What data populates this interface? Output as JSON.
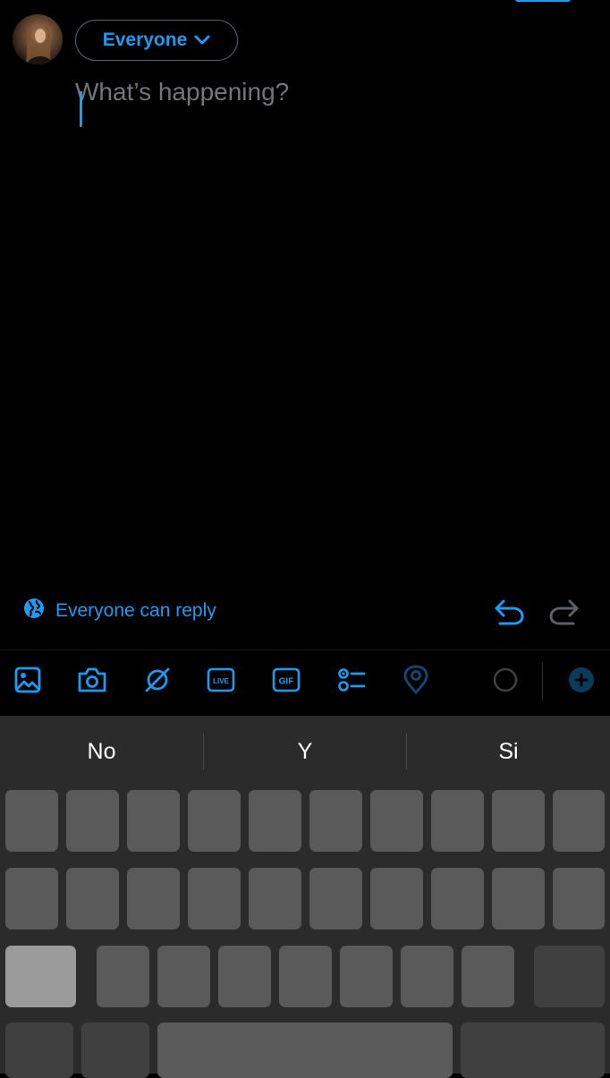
{
  "header": {
    "audience_label": "Everyone"
  },
  "composer": {
    "placeholder": "What’s happening?"
  },
  "reply_setting": {
    "label": "Everyone can reply"
  },
  "toolbar": {
    "icons": [
      "image-icon",
      "camera-icon",
      "grok-icon",
      "live-icon",
      "gif-icon",
      "poll-icon",
      "location-icon",
      "character-count-ring",
      "add-post-icon"
    ],
    "live_text": "LIVE",
    "gif_text": "GIF"
  },
  "keyboard": {
    "suggestions": [
      "No",
      "Y",
      "Si"
    ]
  },
  "colors": {
    "accent": "#1d9bf0",
    "background": "#000000",
    "placeholder": "#71767b",
    "keyboard_bg": "#2b2b2b",
    "key": "#5a5a5a"
  }
}
